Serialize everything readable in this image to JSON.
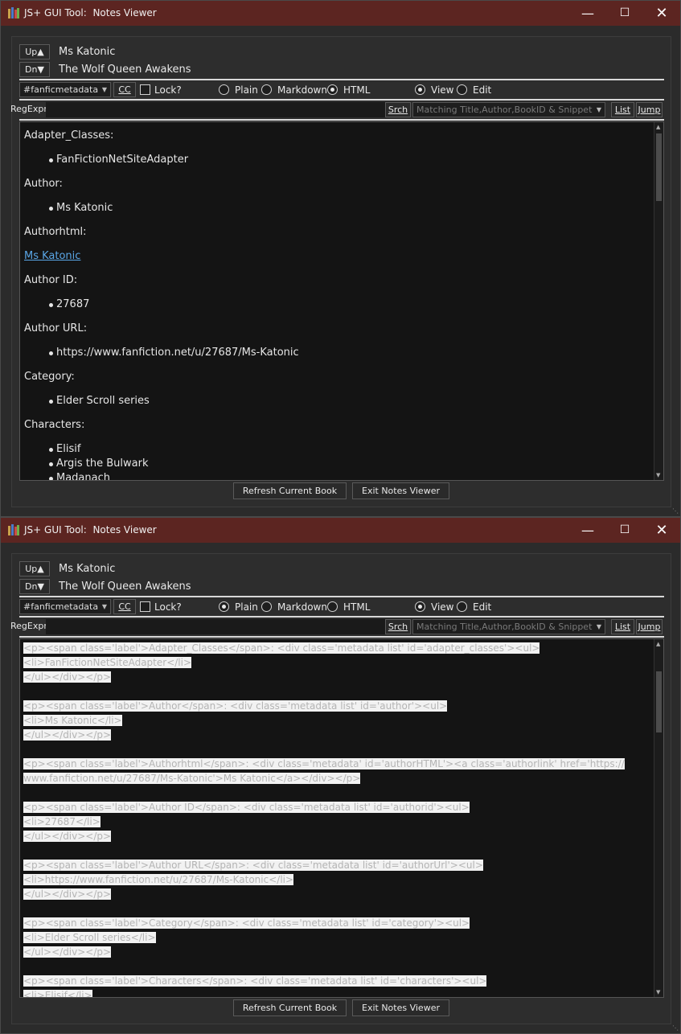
{
  "title": "JS+ GUI Tool:  Notes Viewer",
  "author": "Ms Katonic",
  "book_title": "The Wolf Queen Awakens",
  "up_label": "Up▲",
  "dn_label": "Dn▼",
  "up_key": "Up",
  "dn_key": "Dn",
  "column_combo": "#fanficmetadata",
  "cc_label": "CC",
  "lock_label": "Lock?",
  "mode_plain": "Plain",
  "mode_markdown": "Markdown",
  "mode_html": "HTML",
  "view_label": "View",
  "edit_label": "Edit",
  "regexpr_label": "RegExpr",
  "srch_label": "Srch",
  "search_scope": "Matching Title,Author,BookID & Snippet",
  "list_label": "List",
  "jump_label": "Jump",
  "refresh_label": "Refresh Current Book",
  "exit_label": "Exit Notes Viewer",
  "windows": [
    {
      "mode": "HTML",
      "view_selected": true
    },
    {
      "mode": "Plain",
      "view_selected": true
    }
  ],
  "html_view": {
    "adapter_label": "Adapter_Classes:",
    "adapter_value": "FanFictionNetSiteAdapter",
    "author_label": "Author:",
    "author_value": "Ms Katonic",
    "authorhtml_label": "Authorhtml:",
    "authorhtml_link": "Ms Katonic",
    "authorid_label": "Author ID:",
    "authorid_value": "27687",
    "authorurl_label": "Author URL:",
    "authorurl_value": "https://www.fanfiction.net/u/27687/Ms-Katonic",
    "category_label": "Category:",
    "category_value": "Elder Scroll series",
    "characters_label": "Characters:",
    "characters": [
      "Elisif",
      "Argis the Bulwark",
      "Madanach"
    ]
  },
  "plain_view": {
    "lines": [
      "<p><span class='label'>Adapter_Classes</span>: <div class='metadata list' id='adapter_classes'><ul>",
      "<li>FanFictionNetSiteAdapter</li>",
      "</ul></div></p>",
      "",
      "<p><span class='label'>Author</span>: <div class='metadata list' id='author'><ul>",
      "<li>Ms Katonic</li>",
      "</ul></div></p>",
      "",
      "<p><span class='label'>Authorhtml</span>: <div class='metadata' id='authorHTML'><a class='authorlink' href='https://",
      "www.fanfiction.net/u/27687/Ms-Katonic'>Ms Katonic</a></div></p>",
      "",
      "<p><span class='label'>Author ID</span>: <div class='metadata list' id='authorid'><ul>",
      "<li>27687</li>",
      "</ul></div></p>",
      "",
      "<p><span class='label'>Author URL</span>: <div class='metadata list' id='authorUrl'><ul>",
      "<li>https://www.fanfiction.net/u/27687/Ms-Katonic</li>",
      "</ul></div></p>",
      "",
      "<p><span class='label'>Category</span>: <div class='metadata list' id='category'><ul>",
      "<li>Elder Scroll series</li>",
      "</ul></div></p>",
      "",
      "<p><span class='label'>Characters</span>: <div class='metadata list' id='characters'><ul>",
      "<li>Elisif</li>"
    ]
  }
}
